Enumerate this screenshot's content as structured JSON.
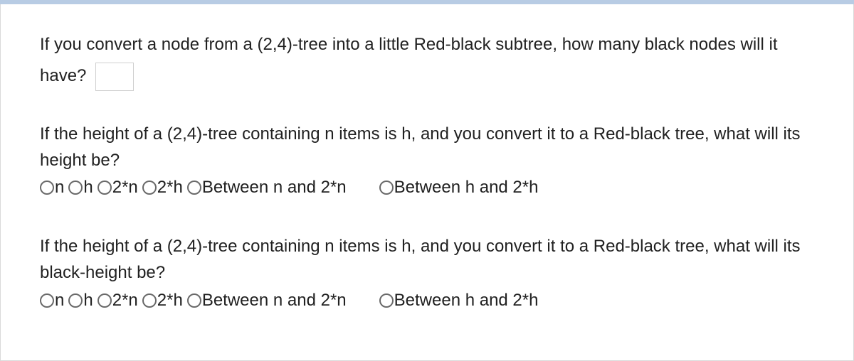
{
  "q1": {
    "text_before": "If you convert a node from a (2,4)-tree into a little Red-black subtree, how many black nodes will it have?",
    "input_value": ""
  },
  "q2": {
    "text": "If the height of a (2,4)-tree containing n items is h, and you convert it to a Red-black tree,  what will its height be?",
    "options": [
      "n",
      "h",
      "2*n",
      "2*h",
      "Between n and 2*n",
      "Between h and 2*h"
    ]
  },
  "q3": {
    "text": "If the height of a (2,4)-tree containing n items is h, and you convert it to a Red-black tree,  what will its black-height be?",
    "options": [
      "n",
      "h",
      "2*n",
      "2*h",
      "Between n and 2*n",
      "Between h and 2*h"
    ]
  }
}
